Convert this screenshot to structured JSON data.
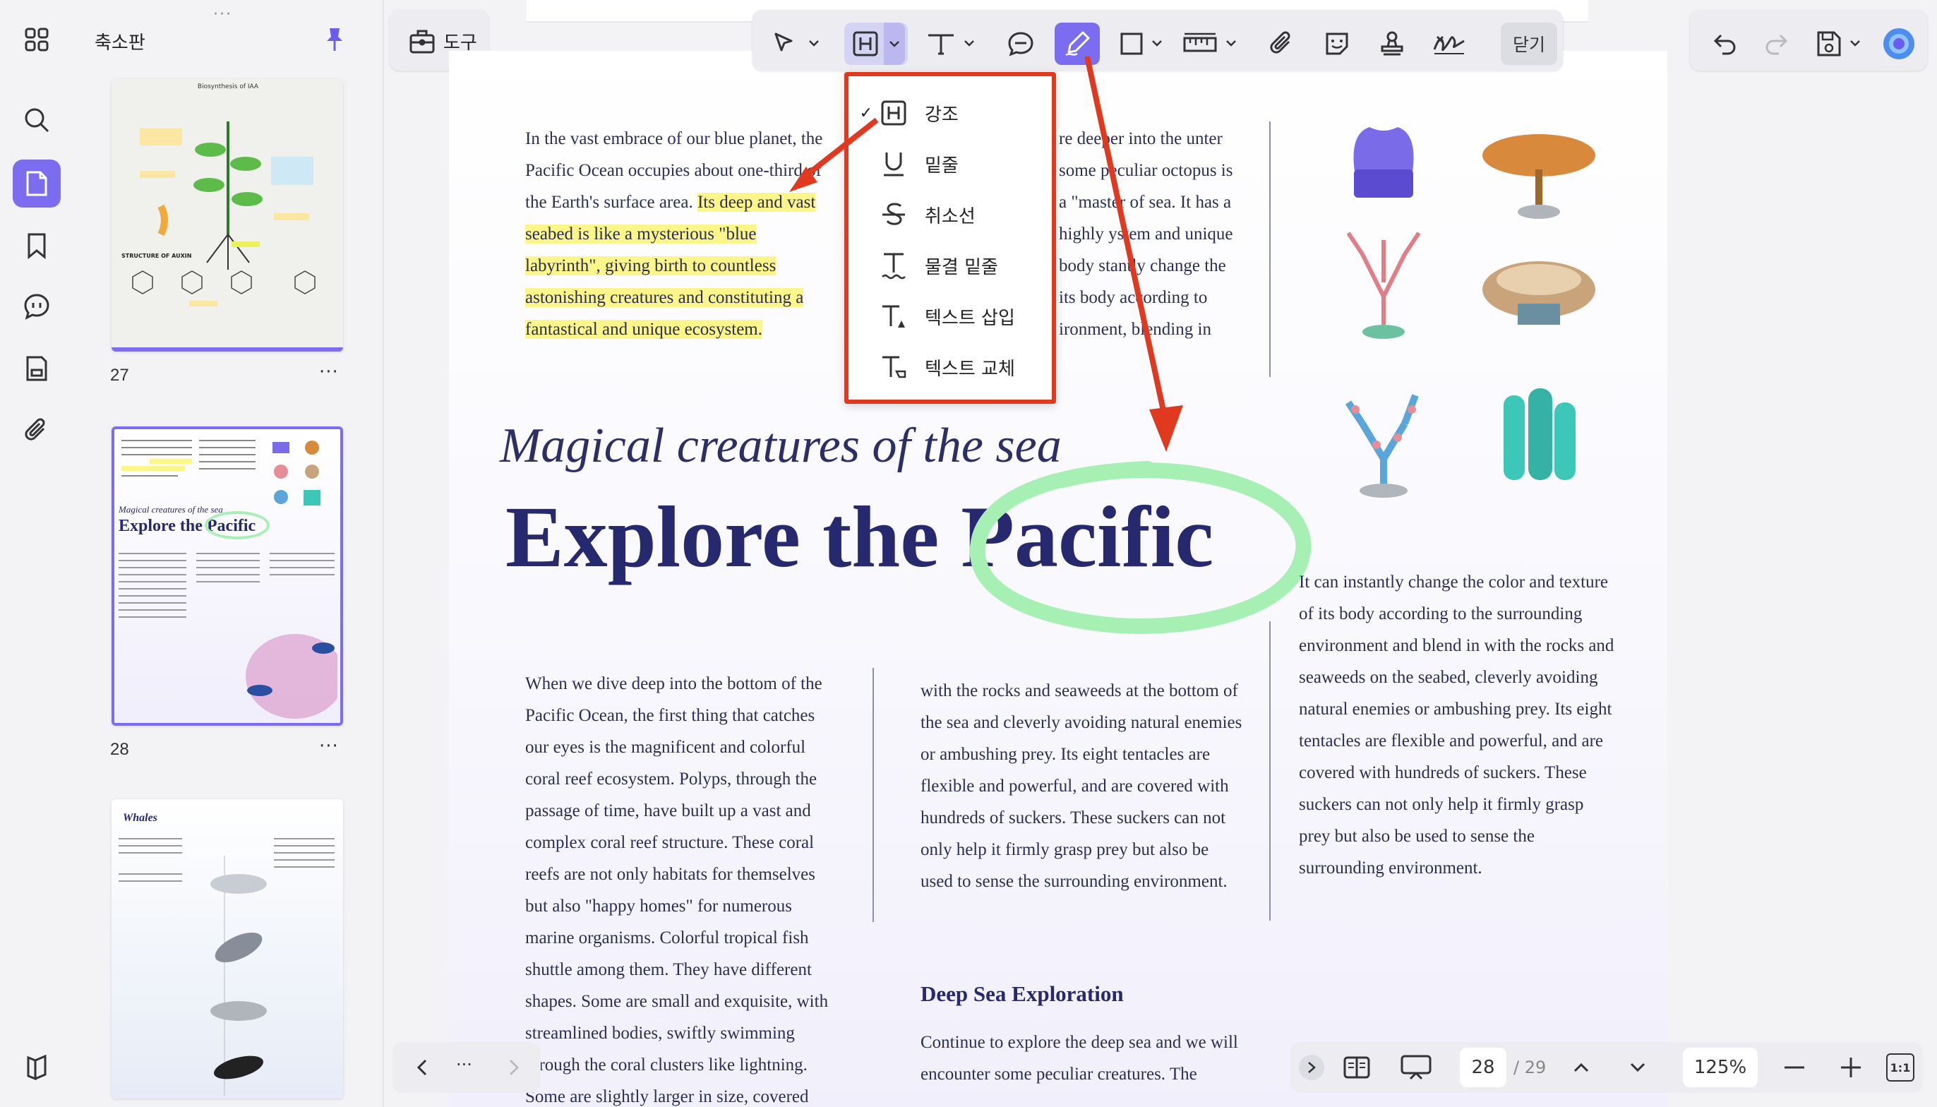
{
  "panel": {
    "title": "축소판"
  },
  "thumbnails": [
    {
      "page": "27",
      "more": "···",
      "mini_title": "Biosynthesis of IAA",
      "mini_caption": "STRUCTURE OF AUXIN"
    },
    {
      "page": "28",
      "more": "···",
      "mini_small": "Magical creatures of the sea",
      "mini_title": "Explore the Pacific"
    },
    {
      "page": "",
      "mini_title": "Whales"
    }
  ],
  "toolbar": {
    "tools_label": "도구",
    "close_label": "닫기"
  },
  "markup_menu": {
    "items": [
      {
        "label": "강조",
        "checked": "✓",
        "icon": "highlight-icon"
      },
      {
        "label": "밑줄",
        "checked": "",
        "icon": "underline-icon"
      },
      {
        "label": "취소선",
        "checked": "",
        "icon": "strikethrough-icon"
      },
      {
        "label": "물결 밑줄",
        "checked": "",
        "icon": "squiggly-underline-icon"
      },
      {
        "label": "텍스트 삽입",
        "checked": "",
        "icon": "insert-text-icon"
      },
      {
        "label": "텍스트 교체",
        "checked": "",
        "icon": "replace-text-icon"
      }
    ]
  },
  "document": {
    "intro_plain": "In the vast embrace of our blue planet, the Pacific Ocean occupies about one-third of the Earth's surface area. ",
    "intro_highlight": "Its deep and vast seabed is like a mysterious \"blue labyrinth\", giving birth to countless astonishing creatures and constituting a fantastical and unique ecosystem.",
    "col2_top": "re deeper into the unter some peculiar octopus is a \"master of sea. It has a highly ystem and unique body stantly change the its body according to ironment, blending in",
    "subtitle": "Magical creatures of the sea",
    "title": "Explore the Pacific",
    "col1_body": "When we dive deep into the bottom of the Pacific Ocean, the first thing that catches our eyes is the magnificent and colorful coral reef ecosystem. Polyps, through the passage of time, have built up a vast and complex coral reef structure. These coral reefs are not only habitats for themselves but also \"happy homes\" for numerous marine organisms. Colorful tropical fish shuttle among them. They have different shapes. Some are small and exquisite, with streamlined bodies, swiftly swimming through the coral clusters like lightning. Some are slightly larger in size, covered",
    "col2_body": "with the rocks and seaweeds at the bottom of the sea and cleverly avoiding natural enemies or ambushing prey. Its eight tentacles are flexible and powerful, and are covered with hundreds of suckers. These suckers can not only help it firmly grasp prey but also be used to sense the surrounding environment.",
    "deep_sea_heading": "Deep Sea Exploration",
    "deep_sea_body": "Continue to explore the deep sea and we will encounter some peculiar creatures. The",
    "col3_body": "It can instantly change the color and texture of its body according to the surrounding environment and blend in with the rocks and seaweeds on the seabed, cleverly avoiding natural enemies or ambushing prey. Its eight tentacles are flexible and powerful, and are covered with hundreds of suckers. These suckers can not only help it firmly grasp prey but also be used to sense the surrounding environment."
  },
  "bottom_bar": {
    "current_page": "28",
    "total_pages": "/ 29",
    "zoom": "125%",
    "more": "···",
    "ratio_label": "1:1"
  },
  "colors": {
    "accent": "#7c6cf0",
    "annotation_red": "#e0391f",
    "circle_green": "#a6f0b4",
    "highlight": "#fcf58a",
    "title_navy": "#26296e"
  }
}
